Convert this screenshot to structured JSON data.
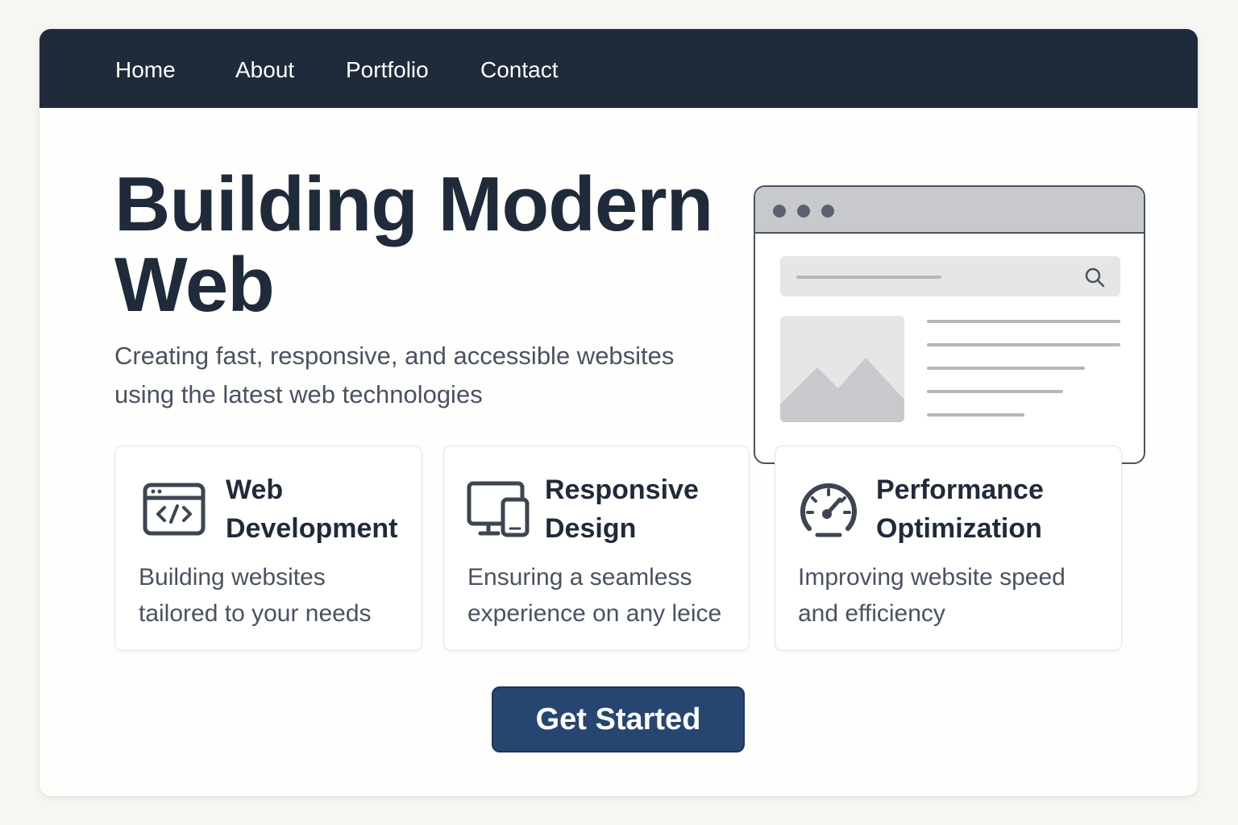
{
  "nav": {
    "items": [
      {
        "label": "Home"
      },
      {
        "label": "About"
      },
      {
        "label": "Portfolio"
      },
      {
        "label": "Contact"
      }
    ]
  },
  "hero": {
    "title_line1": "Building Modern",
    "title_line2": "Web",
    "subtitle_line1": "Creating fast, responsive, and accessible websites",
    "subtitle_line2": "using the latest web technologies"
  },
  "features": [
    {
      "icon": "code-window-icon",
      "title_line1": "Web",
      "title_line2": "Development",
      "desc_line1": "Building websites",
      "desc_line2": "tailored to your needs"
    },
    {
      "icon": "devices-icon",
      "title_line1": "Responsive",
      "title_line2": "Design",
      "desc_line1": "Ensuring a seamless",
      "desc_line2": "experience on any leice"
    },
    {
      "icon": "speedometer-icon",
      "title_line1": "Performance",
      "title_line2": "Optimization",
      "desc_line1": "Improving website speed",
      "desc_line2": "and efficiency"
    }
  ],
  "cta": {
    "label": "Get Started"
  },
  "colors": {
    "nav_bg": "#1f2a3a",
    "heading": "#1f2a3a",
    "body_text": "#4a5261",
    "button_bg": "#264570",
    "page_bg": "#f6f6f3"
  }
}
